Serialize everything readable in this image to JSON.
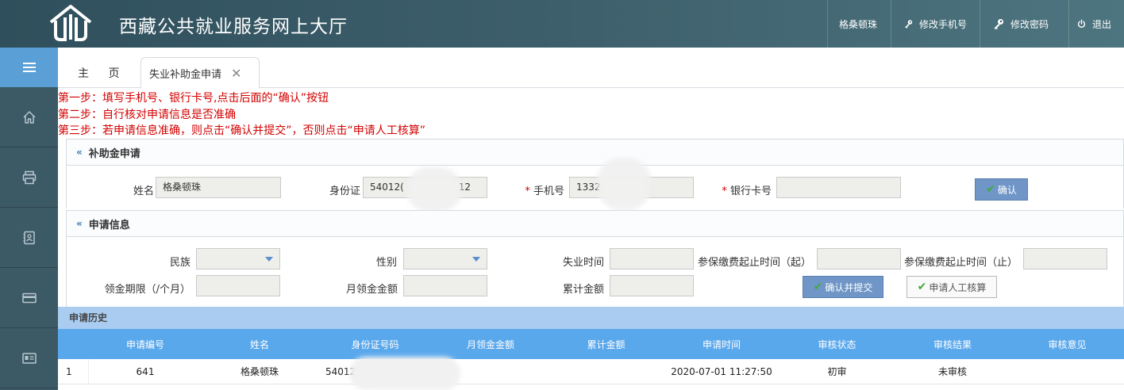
{
  "header": {
    "site_title": "西藏公共就业服务网上大厅",
    "user_name": "格桑顿珠",
    "change_phone": "修改手机号",
    "change_password": "修改密码",
    "logout": "退出"
  },
  "tabs": {
    "home": "主 页",
    "active": "失业补助金申请",
    "close": "✕"
  },
  "steps": [
    "第一步：填写手机号、银行卡号,点击后面的“确认”按钮",
    "第二步：自行核对申请信息是否准确",
    "第三步：若申请信息准确，则点击“确认并提交”，否则点击“申请人工核算”"
  ],
  "subsidy_panel": {
    "title": "补助金申请",
    "name_label": "姓名",
    "name_value": "格桑顿珠",
    "id_label": "身份证",
    "id_value_start": "54012(",
    "id_value_end": "12",
    "required_mark": "*",
    "phone_label": "手机号",
    "phone_value": "1332",
    "bank_label": "银行卡号",
    "bank_value": "",
    "confirm_button": "确认"
  },
  "info_panel": {
    "title": "申请信息",
    "ethnicity_label": "民族",
    "gender_label": "性别",
    "unemployment_time_label": "失业时间",
    "insurance_start_label": "参保缴费起止时间（起）",
    "insurance_end_label": "参保缴费起止时间（止）",
    "duration_label": "领金期限（/个月）",
    "monthly_amount_label": "月领金金额",
    "total_amount_label": "累计金额",
    "submit_button": "确认并提交",
    "manual_button": "申请人工核算"
  },
  "history": {
    "title": "申请历史",
    "columns": [
      "申请编号",
      "姓名",
      "身份证号码",
      "月领金金额",
      "累计金额",
      "申请时间",
      "审核状态",
      "审核结果",
      "审核意见"
    ],
    "rows": [
      {
        "index": "1",
        "number": "641",
        "name": "格桑顿珠",
        "id": "54012",
        "monthly": "",
        "total": "",
        "time": "2020-07-01 11:27:50",
        "status": "初审",
        "result": "未审核",
        "opinion": ""
      }
    ]
  },
  "colors": {
    "header_bg": "#3d5f6b",
    "sidebar_bg": "#3c5966",
    "sidebar_active": "#5aa0d6",
    "step_text": "#d30000",
    "table_header": "#5aa8ec",
    "history_bar": "#a9ccf0"
  },
  "icons": {
    "logo": "house-logo-icon",
    "key": "key-icon",
    "power": "power-icon",
    "menu": "hamburger-menu-icon",
    "home": "home-icon",
    "printer": "printer-icon",
    "contacts": "contact-book-icon",
    "card": "credit-card-icon",
    "id_card": "id-card-icon"
  }
}
